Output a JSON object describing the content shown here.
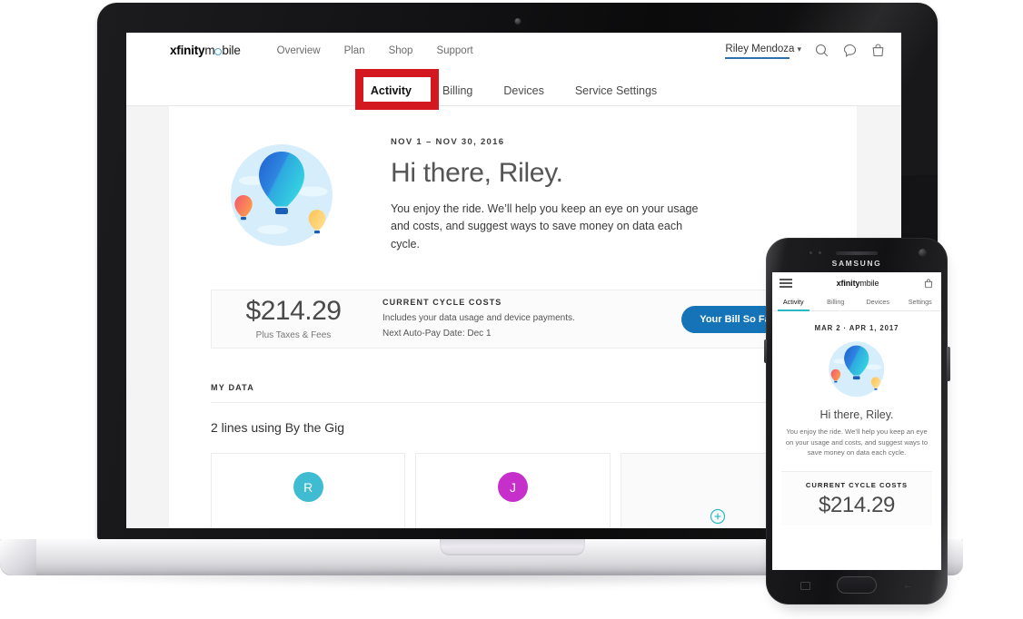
{
  "brand": {
    "bold": "xfinity",
    "light_pre": "m",
    "light_post": "bile",
    "ring_icon": "o-ring-logo-mark"
  },
  "desktop": {
    "topnav": {
      "links": [
        "Overview",
        "Plan",
        "Shop",
        "Support"
      ],
      "user_name": "Riley Mendoza",
      "caret": "⌄",
      "icons": [
        "search-icon",
        "chat-bubble-icon",
        "shopping-bag-icon"
      ]
    },
    "tabs": [
      {
        "label": "Activity",
        "active": true
      },
      {
        "label": "Billing",
        "active": false
      },
      {
        "label": "Devices",
        "active": false,
        "highlighted": true
      },
      {
        "label": "Service Settings",
        "active": false
      }
    ],
    "hero": {
      "eyebrow": "NOV 1 – NOV 30, 2016",
      "heading": "Hi there, Riley.",
      "body": "You enjoy the ride. We’ll help you keep an eye on your usage and costs, and suggest ways to save money on data each cycle.",
      "illustration": "hot-air-balloon-illustration"
    },
    "cost": {
      "amount": "$214.29",
      "amount_note": "Plus Taxes & Fees",
      "heading": "CURRENT CYCLE COSTS",
      "line1": "Includes your data usage and device payments.",
      "line2": "Next Auto-Pay Date: Dec 1",
      "button": "Your Bill So Far"
    },
    "mydata": {
      "heading": "MY DATA",
      "summary": "2 lines using By the Gig",
      "devices": [
        {
          "initial": "R",
          "color": "#3fbcd2"
        },
        {
          "initial": "J",
          "color": "#c62fca"
        },
        {
          "initial": "",
          "color": "",
          "add": true
        }
      ]
    }
  },
  "phone": {
    "device_label": "SAMSUNG",
    "nav_icons": [
      "hamburger-menu-icon",
      "shopping-bag-icon"
    ],
    "tabs": [
      {
        "label": "Activity",
        "active": true
      },
      {
        "label": "Billing",
        "active": false
      },
      {
        "label": "Devices",
        "active": false
      },
      {
        "label": "Settings",
        "active": false
      }
    ],
    "date": "MAR 2 · APR 1, 2017",
    "heading": "Hi there, Riley.",
    "body": "You enjoy the ride. We’ll help you keep an eye on your usage and costs, and suggest ways to save money on data each cycle.",
    "cost_heading": "CURRENT CYCLE COSTS",
    "cost_amount": "$214.29"
  },
  "colors": {
    "accent_teal": "#2bb8c4",
    "accent_blue": "#1574b8",
    "highlight_red": "#d41820",
    "user_underline": "#2e6fb0"
  }
}
